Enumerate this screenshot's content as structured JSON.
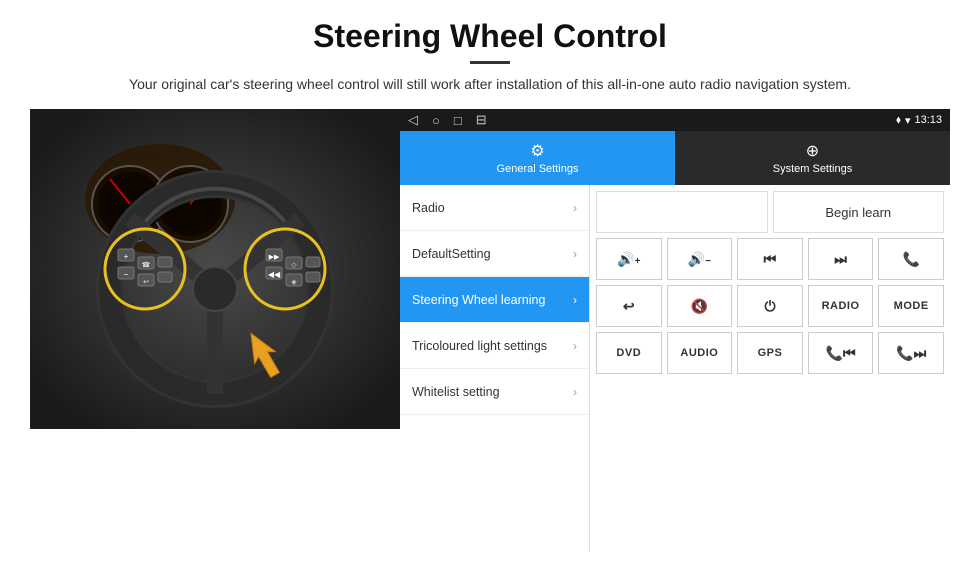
{
  "header": {
    "title": "Steering Wheel Control",
    "divider": true,
    "subtitle": "Your original car's steering wheel control will still work after installation of this all-in-one auto radio navigation system."
  },
  "status_bar": {
    "time": "13:13",
    "nav_icons": [
      "◁",
      "○",
      "□",
      "⊟"
    ],
    "signal_icon": "♦",
    "wifi_icon": "▾"
  },
  "tabs": [
    {
      "id": "general",
      "label": "General Settings",
      "icon": "⚙",
      "active": true
    },
    {
      "id": "system",
      "label": "System Settings",
      "icon": "⊕",
      "active": false
    }
  ],
  "menu_items": [
    {
      "id": "radio",
      "label": "Radio",
      "active": false
    },
    {
      "id": "default_setting",
      "label": "DefaultSetting",
      "active": false
    },
    {
      "id": "steering_wheel",
      "label": "Steering Wheel learning",
      "active": true
    },
    {
      "id": "tricoloured",
      "label": "Tricoloured light settings",
      "active": false
    },
    {
      "id": "whitelist",
      "label": "Whitelist setting",
      "active": false
    }
  ],
  "controls": {
    "begin_learn": "Begin learn",
    "row1": [
      "🔊+",
      "🔊−",
      "⏮",
      "⏭",
      "📞"
    ],
    "row2": [
      "↩",
      "🔊×",
      "⏻",
      "RADIO",
      "MODE"
    ],
    "row3": [
      "DVD",
      "AUDIO",
      "GPS",
      "📞⏮",
      "📞⏭"
    ]
  }
}
